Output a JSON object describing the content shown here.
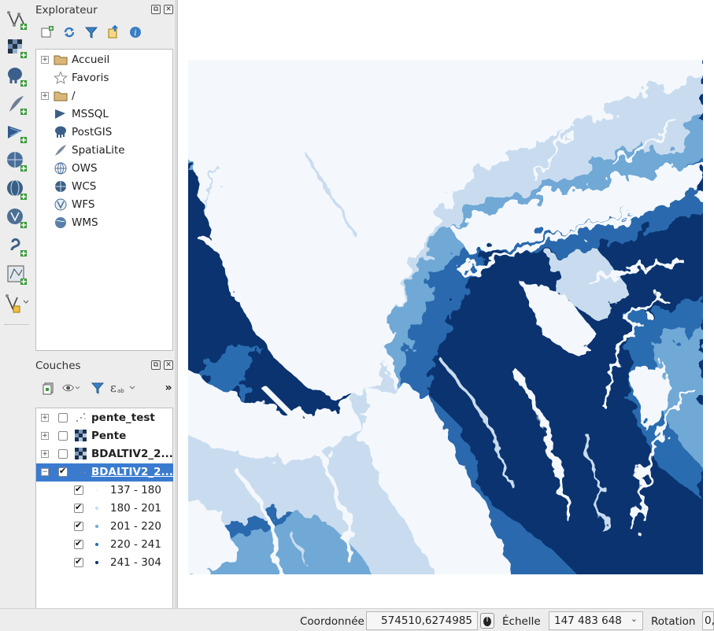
{
  "explorer": {
    "title": "Explorateur",
    "items": [
      {
        "label": "Accueil",
        "expandable": true,
        "icon": "folder-icon"
      },
      {
        "label": "Favoris",
        "expandable": false,
        "icon": "star-icon"
      },
      {
        "label": "/",
        "expandable": true,
        "icon": "folder-icon"
      },
      {
        "label": "MSSQL",
        "expandable": false,
        "icon": "mssql-icon"
      },
      {
        "label": "PostGIS",
        "expandable": false,
        "icon": "postgis-elephant-icon"
      },
      {
        "label": "SpatiaLite",
        "expandable": false,
        "icon": "spatialite-feather-icon"
      },
      {
        "label": "OWS",
        "expandable": false,
        "icon": "ows-globe-icon"
      },
      {
        "label": "WCS",
        "expandable": false,
        "icon": "wcs-globe-icon"
      },
      {
        "label": "WFS",
        "expandable": false,
        "icon": "wfs-globe-icon"
      },
      {
        "label": "WMS",
        "expandable": false,
        "icon": "wms-globe-icon"
      }
    ]
  },
  "layers": {
    "title": "Couches",
    "items": [
      {
        "label": "pente_test",
        "checked": false,
        "selected": false,
        "icon": "point-layer-icon"
      },
      {
        "label": "Pente",
        "checked": false,
        "selected": false,
        "icon": "raster-layer-icon"
      },
      {
        "label": "BDALTIV2_2...",
        "checked": false,
        "selected": false,
        "icon": "raster-layer-icon"
      },
      {
        "label": "BDALTIV2_2...",
        "checked": true,
        "selected": true,
        "icon": "point-layer-icon"
      }
    ],
    "classes": [
      {
        "label": "137 - 180",
        "color": "#f4f8fd"
      },
      {
        "label": "180 - 201",
        "color": "#c9dcef"
      },
      {
        "label": "201 - 220",
        "color": "#6fa8d6"
      },
      {
        "label": "220 - 241",
        "color": "#2a6cb0"
      },
      {
        "label": "241 - 304",
        "color": "#0a3370"
      }
    ]
  },
  "statusbar": {
    "coord_label": "Coordonnée",
    "coord_value": "574510,6274985",
    "scale_label": "Échelle",
    "scale_value": "147 483 648",
    "rotation_label": "Rotation",
    "rotation_value": "0,"
  },
  "colors": {
    "class_1": "#f4f8fd",
    "class_2": "#c9dcef",
    "class_3": "#6fa8d6",
    "class_4": "#2a6cb0",
    "class_5": "#0a3370",
    "selection": "#3a7bd0"
  }
}
